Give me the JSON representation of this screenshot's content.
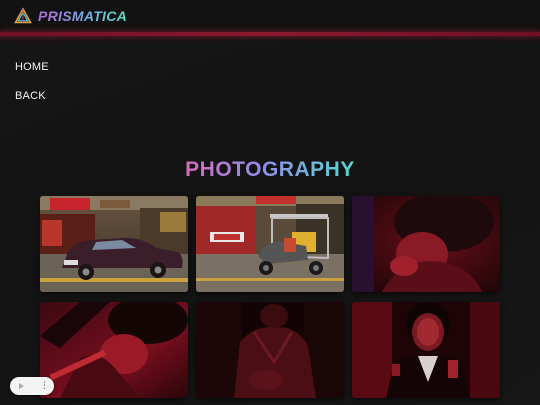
{
  "brand": {
    "name": "PRISMATICA",
    "logo_icon": "prism-triangle-icon"
  },
  "nav": {
    "items": [
      {
        "label": "HOME"
      },
      {
        "label": "BACK"
      }
    ]
  },
  "section": {
    "title": "PHOTOGRAPHY"
  },
  "gallery": {
    "photos": [
      {
        "subject": "car-street-photo"
      },
      {
        "subject": "tricycle-street-photo"
      },
      {
        "subject": "red-portrait-photo"
      },
      {
        "subject": "red-silhouette-photo"
      },
      {
        "subject": "dark-red-figure-photo"
      },
      {
        "subject": "young-man-portrait-photo"
      }
    ]
  },
  "player_widget": {
    "play_icon": "play-icon",
    "menu_icon": "more-vertical-icon"
  },
  "colors": {
    "background": "#141414",
    "header_glow": "#8a1a30",
    "gradient_pink": "#d66bbd",
    "gradient_teal": "#59d7cf"
  }
}
